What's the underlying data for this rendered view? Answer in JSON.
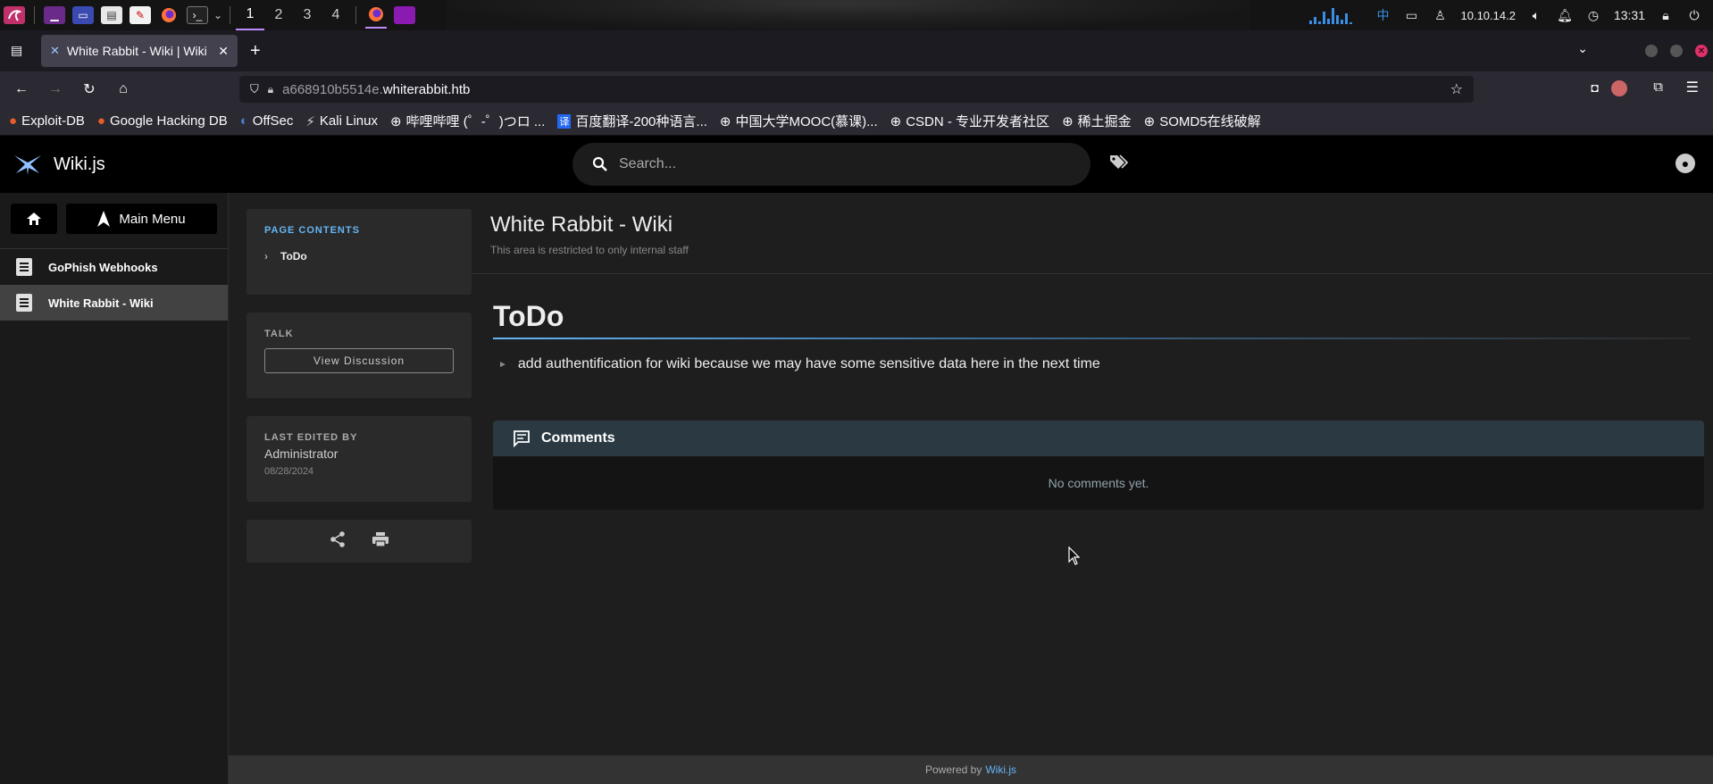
{
  "os": {
    "workspaces": [
      "1",
      "2",
      "3",
      "4"
    ],
    "ip": "10.10.14.2",
    "clock": "13:31",
    "ime": "中"
  },
  "browser": {
    "tab_title": "White Rabbit - Wiki | Wiki",
    "url_prefix": "a668910b5514e.",
    "url_domain": "whiterabbit.htb",
    "bookmarks": [
      "Exploit-DB",
      "Google Hacking DB",
      "OffSec",
      "Kali Linux",
      "哔哩哔哩 (゜-゜)つロ ...",
      "百度翻译-200种语言...",
      "中国大学MOOC(慕课)...",
      "CSDN - 专业开发者社区",
      "稀土掘金",
      "SOMD5在线破解"
    ]
  },
  "header": {
    "brand": "Wiki.js",
    "search_placeholder": "Search..."
  },
  "sidenav": {
    "main_menu_label": "Main Menu",
    "items": [
      {
        "label": "GoPhish Webhooks"
      },
      {
        "label": "White Rabbit - Wiki"
      }
    ]
  },
  "toc": {
    "caption": "PAGE CONTENTS",
    "items": [
      "ToDo"
    ]
  },
  "talk": {
    "caption": "TALK",
    "button": "View Discussion"
  },
  "last_edit": {
    "caption": "LAST EDITED BY",
    "author": "Administrator",
    "date": "08/28/2024"
  },
  "page": {
    "title": "White Rabbit - Wiki",
    "description": "This area is restricted to only internal staff",
    "heading": "ToDo",
    "todo_item": "add authentification for wiki because we may have some sensitive data here in the next time"
  },
  "comments": {
    "title": "Comments",
    "empty": "No comments yet."
  },
  "footer": {
    "prefix": "Powered by",
    "link": "Wiki.js"
  },
  "colors": {
    "accent": "#64b5f6",
    "header_bg": "#000000",
    "comments_header": "#2b3a42"
  }
}
